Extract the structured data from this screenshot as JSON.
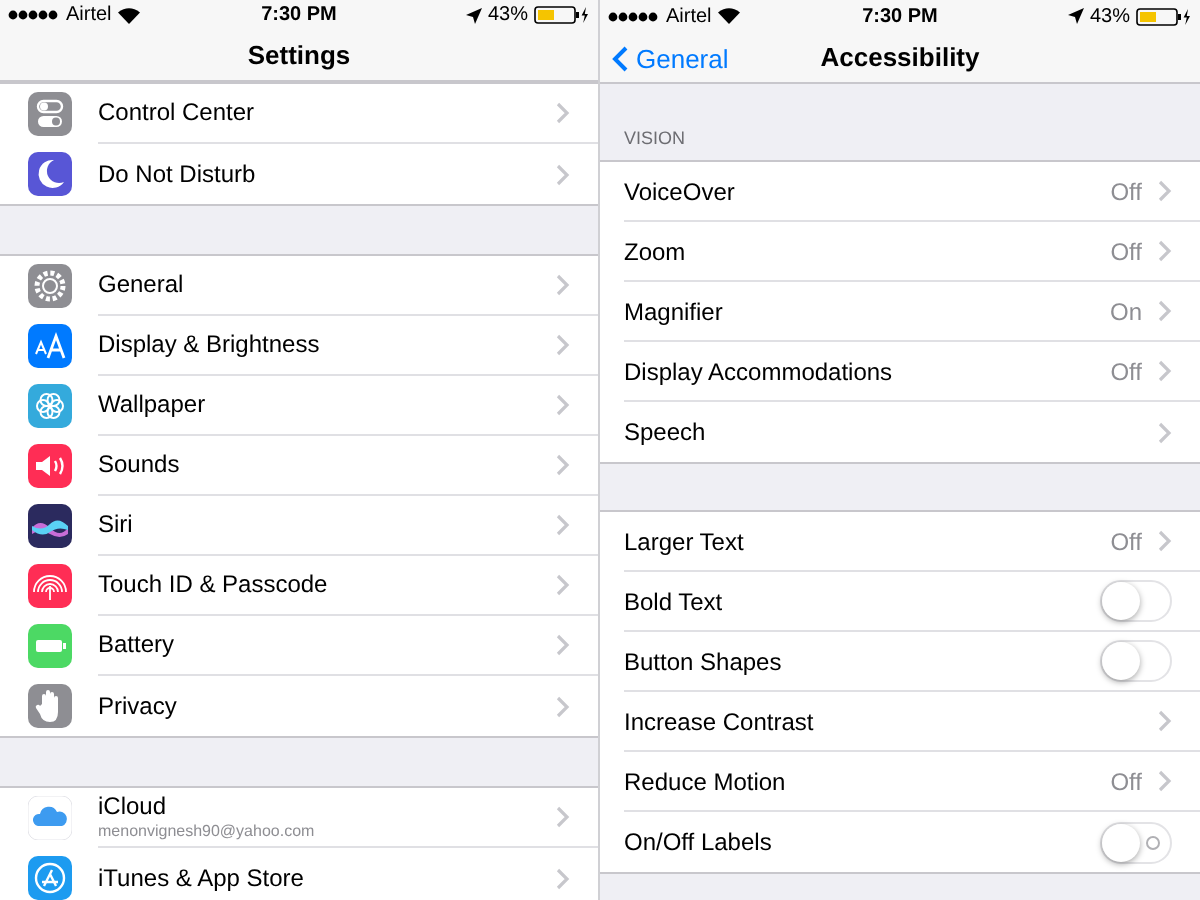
{
  "settings_screen": {
    "status_bar": {
      "carrier": "Airtel",
      "time": "7:30 PM",
      "battery": "43%"
    },
    "nav": {
      "title": "Settings"
    },
    "groups": [
      {
        "rows": [
          {
            "label": "Control Center"
          },
          {
            "label": "Do Not Disturb"
          }
        ]
      },
      {
        "rows": [
          {
            "label": "General"
          },
          {
            "label": "Display & Brightness"
          },
          {
            "label": "Wallpaper"
          },
          {
            "label": "Sounds"
          },
          {
            "label": "Siri"
          },
          {
            "label": "Touch ID & Passcode"
          },
          {
            "label": "Battery"
          },
          {
            "label": "Privacy"
          }
        ]
      },
      {
        "rows": [
          {
            "label": "iCloud",
            "subtitle": "menonvignesh90@yahoo.com"
          },
          {
            "label": "iTunes & App Store"
          }
        ]
      }
    ]
  },
  "accessibility_screen": {
    "status_bar": {
      "carrier": "Airtel",
      "time": "7:30 PM",
      "battery": "43%"
    },
    "nav": {
      "back": "General",
      "title": "Accessibility"
    },
    "groups": [
      {
        "header": "VISION",
        "rows": [
          {
            "label": "VoiceOver",
            "kind": "value",
            "value": "Off"
          },
          {
            "label": "Zoom",
            "kind": "value",
            "value": "Off"
          },
          {
            "label": "Magnifier",
            "kind": "value",
            "value": "On"
          },
          {
            "label": "Display Accommodations",
            "kind": "value",
            "value": "Off"
          },
          {
            "label": "Speech",
            "kind": "link"
          }
        ]
      },
      {
        "rows": [
          {
            "label": "Larger Text",
            "kind": "value",
            "value": "Off"
          },
          {
            "label": "Bold Text",
            "kind": "toggle",
            "on": false,
            "labeled": false
          },
          {
            "label": "Button Shapes",
            "kind": "toggle",
            "on": false,
            "labeled": false
          },
          {
            "label": "Increase Contrast",
            "kind": "link"
          },
          {
            "label": "Reduce Motion",
            "kind": "value",
            "value": "Off"
          },
          {
            "label": "On/Off Labels",
            "kind": "toggle",
            "on": false,
            "labeled": true
          }
        ]
      }
    ]
  }
}
